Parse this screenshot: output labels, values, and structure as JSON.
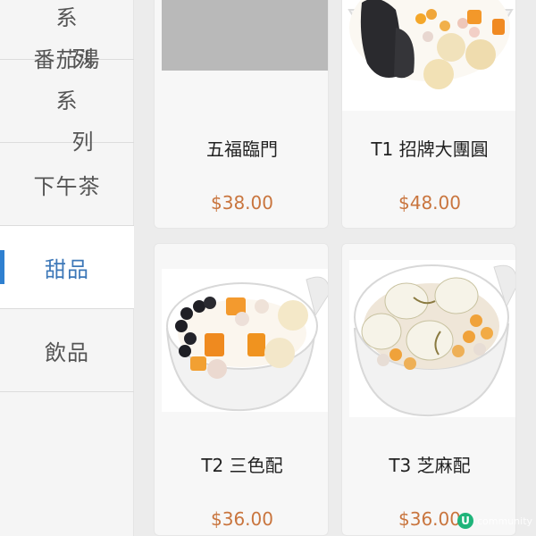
{
  "sidebar": {
    "items": [
      {
        "line1": "粥粉湯系",
        "line2": "列"
      },
      {
        "line1": "番茄湯系",
        "line2": "列"
      },
      {
        "label": "下午茶"
      },
      {
        "label": "甜品"
      },
      {
        "label": "飲品"
      }
    ],
    "active_index": 3
  },
  "products": [
    {
      "name": "五福臨門",
      "price": "$38.00",
      "image": "gray-placeholder"
    },
    {
      "name": "T1 招牌大團圓",
      "price": "$48.00",
      "image": "dessert-bowl-black-jelly-taro-balls"
    },
    {
      "name": "T2 三色配",
      "price": "$36.00",
      "image": "dessert-bowl-taro-balls-sago"
    },
    {
      "name": "T3 芝麻配",
      "price": "$36.00",
      "image": "dessert-bowl-sesame-glutinous-balls"
    }
  ],
  "watermark": {
    "text": "community",
    "logo_letter": "U",
    "logo_color": "#1fb47a"
  },
  "colors": {
    "accent": "#2f80d0",
    "active_text": "#3d78b8",
    "price": "#c9753e"
  }
}
